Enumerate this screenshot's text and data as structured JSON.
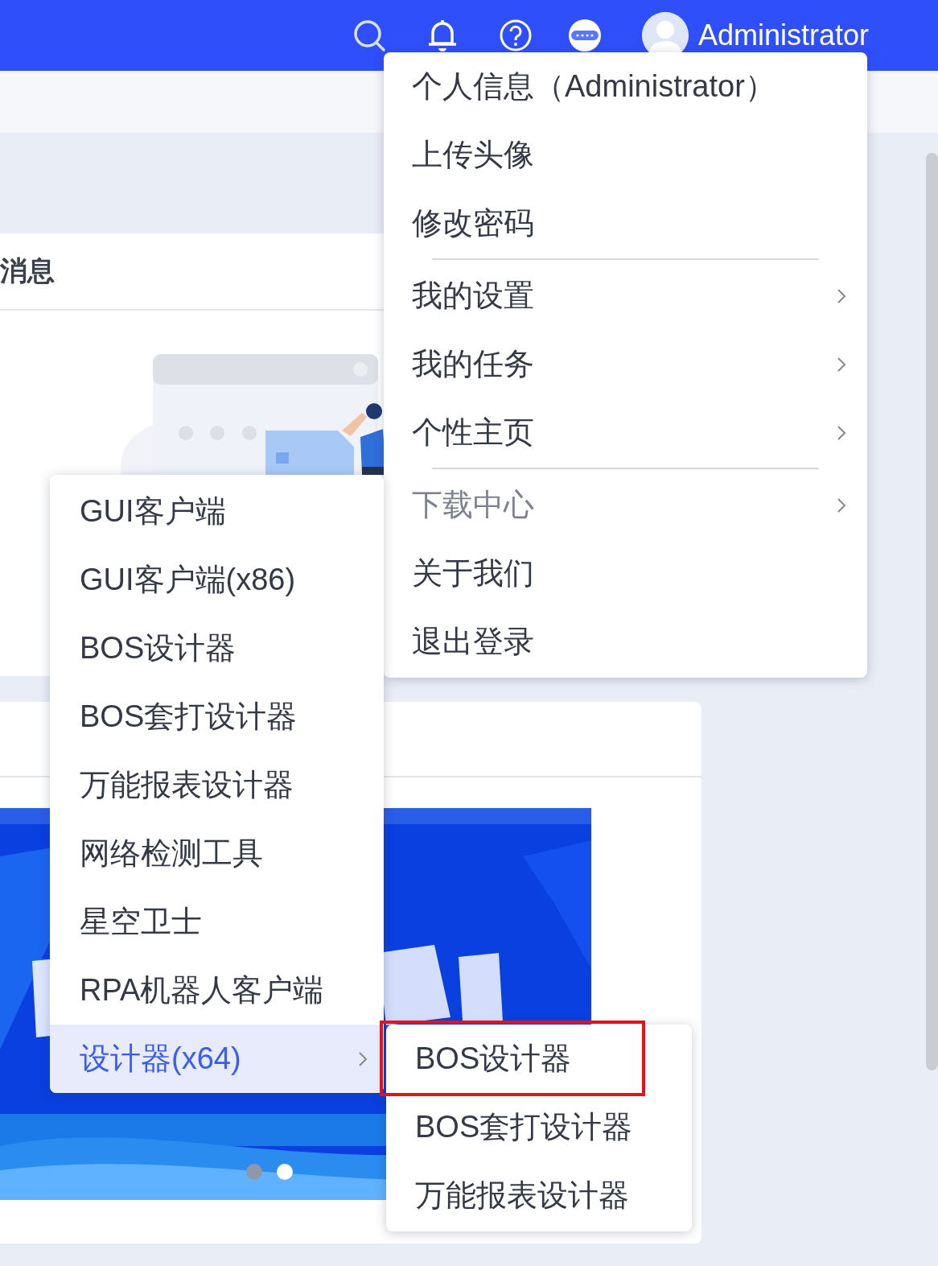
{
  "top_bar": {
    "user_name": "Administrator"
  },
  "message_card": {
    "title": "消息"
  },
  "banner_card": {
    "carousel_dots": [
      {
        "selected": false
      },
      {
        "selected": true
      }
    ]
  },
  "user_menu": {
    "items": [
      {
        "kind": "item",
        "label": "个人信息（Administrator）",
        "has_submenu": false,
        "expanded": false
      },
      {
        "kind": "item",
        "label": "上传头像",
        "has_submenu": false,
        "expanded": false
      },
      {
        "kind": "item",
        "label": "修改密码",
        "has_submenu": false,
        "expanded": false
      },
      {
        "kind": "divider"
      },
      {
        "kind": "item",
        "label": "我的设置",
        "has_submenu": true,
        "expanded": false
      },
      {
        "kind": "item",
        "label": "我的任务",
        "has_submenu": true,
        "expanded": false
      },
      {
        "kind": "item",
        "label": "个性主页",
        "has_submenu": true,
        "expanded": false
      },
      {
        "kind": "divider"
      },
      {
        "kind": "item",
        "label": "下载中心",
        "has_submenu": true,
        "expanded": true
      },
      {
        "kind": "item",
        "label": "关于我们",
        "has_submenu": false,
        "expanded": false
      },
      {
        "kind": "item",
        "label": "退出登录",
        "has_submenu": false,
        "expanded": false
      }
    ]
  },
  "download_menu": {
    "items": [
      {
        "label": "GUI客户端",
        "has_submenu": false,
        "selected": false
      },
      {
        "label": "GUI客户端(x86)",
        "has_submenu": false,
        "selected": false
      },
      {
        "label": "BOS设计器",
        "has_submenu": false,
        "selected": false
      },
      {
        "label": "BOS套打设计器",
        "has_submenu": false,
        "selected": false
      },
      {
        "label": "万能报表设计器",
        "has_submenu": false,
        "selected": false
      },
      {
        "label": "网络检测工具",
        "has_submenu": false,
        "selected": false
      },
      {
        "label": "星空卫士",
        "has_submenu": false,
        "selected": false
      },
      {
        "label": "RPA机器人客户端",
        "has_submenu": false,
        "selected": false
      },
      {
        "label": "设计器(x64)",
        "has_submenu": true,
        "selected": true
      }
    ]
  },
  "designer_menu": {
    "items": [
      {
        "label": "BOS设计器",
        "highlighted": true
      },
      {
        "label": "BOS套打设计器",
        "highlighted": false
      },
      {
        "label": "万能报表设计器",
        "highlighted": false
      }
    ]
  }
}
